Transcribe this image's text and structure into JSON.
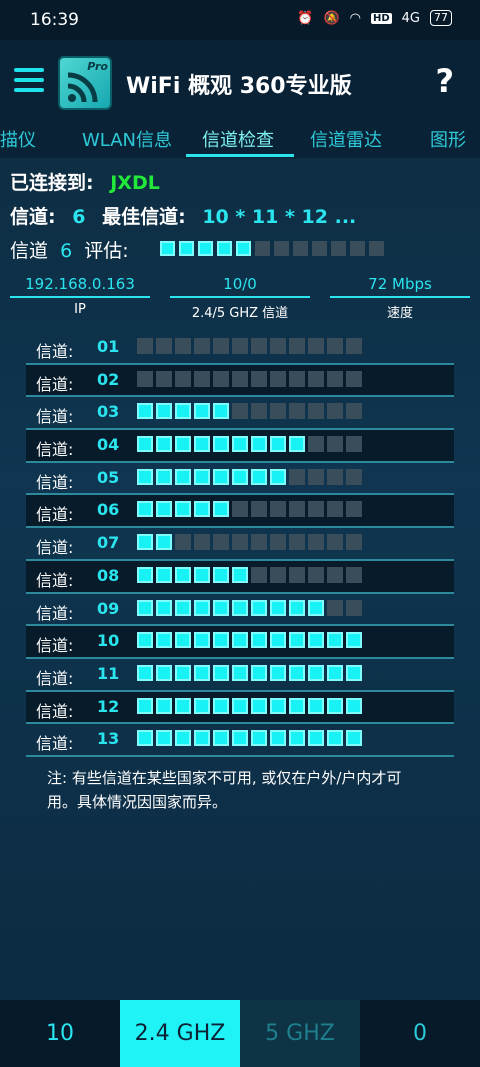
{
  "status": {
    "time": "16:39",
    "signal": "4G",
    "hd": "HD",
    "battery": "77"
  },
  "app": {
    "title": "WiFi 概观 360专业版",
    "logo_badge": "Pro",
    "help": "?"
  },
  "tabs": [
    "扫描仪",
    "WLAN信息",
    "信道检查",
    "信道雷达",
    "图形"
  ],
  "info": {
    "connected_label": "已连接到:",
    "ssid": "JXDL",
    "channel_label": "信道:",
    "channel": "6",
    "best_label": "最佳信道:",
    "best": "10 * 11 * 12 ...",
    "rating_label_1": "信道",
    "rating_channel": "6",
    "rating_label_2": "评估:",
    "rating_value": 5,
    "rating_max": 12
  },
  "stats": [
    {
      "value": "192.168.0.163",
      "label": "IP"
    },
    {
      "value": "10/0",
      "label": "2.4/5 GHZ 信道"
    },
    {
      "value": "72 Mbps",
      "label": "速度"
    }
  ],
  "channel_rows": {
    "label": "信道:",
    "max": 12,
    "items": [
      {
        "num": "01",
        "level": 0
      },
      {
        "num": "02",
        "level": 0
      },
      {
        "num": "03",
        "level": 5
      },
      {
        "num": "04",
        "level": 9
      },
      {
        "num": "05",
        "level": 8
      },
      {
        "num": "06",
        "level": 5
      },
      {
        "num": "07",
        "level": 2
      },
      {
        "num": "08",
        "level": 6
      },
      {
        "num": "09",
        "level": 10
      },
      {
        "num": "10",
        "level": 12
      },
      {
        "num": "11",
        "level": 12
      },
      {
        "num": "12",
        "level": 12
      },
      {
        "num": "13",
        "level": 12
      }
    ]
  },
  "note": "注: 有些信道在某些国家不可用, 或仅在户外/户内才可用。具体情况因国家而异。",
  "bottom": {
    "count_24": "10",
    "band_24": "2.4 GHZ",
    "band_5": "5 GHZ",
    "count_5": "0"
  },
  "colors": {
    "accent": "#2ae4ee",
    "connected": "#22e83a",
    "block_on": "#19f2f5",
    "block_off": "#3a4d5b"
  }
}
